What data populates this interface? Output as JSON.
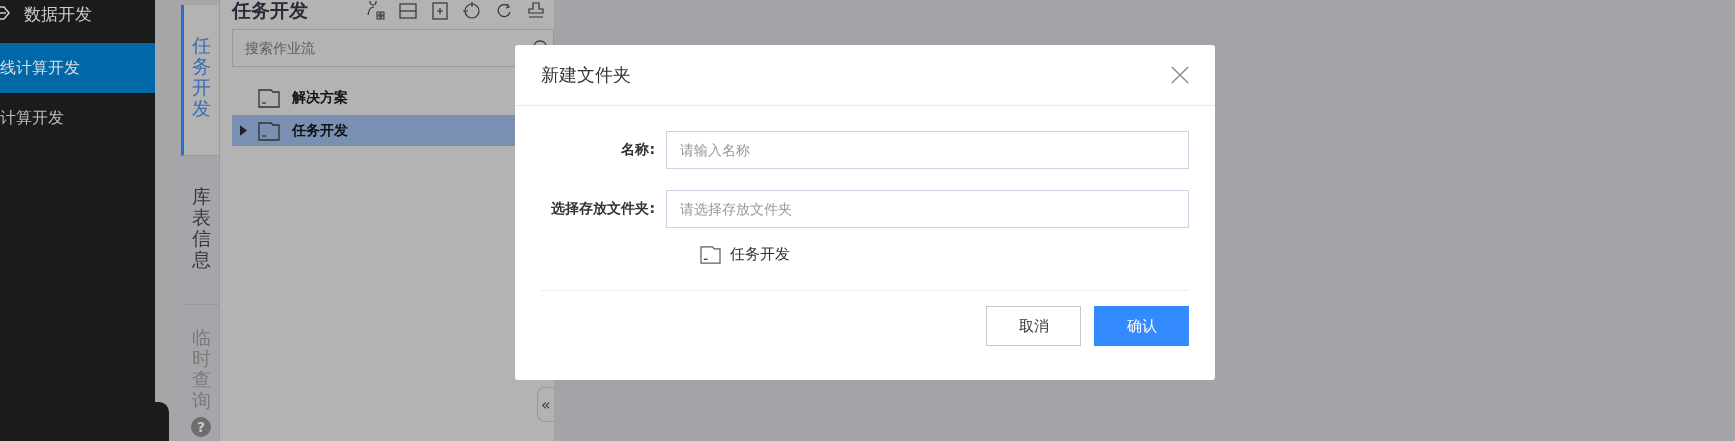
{
  "sidebar": {
    "header": "数据开发",
    "items": [
      {
        "label": "线计算开发",
        "selected": true
      },
      {
        "label": "计算开发",
        "selected": false
      }
    ]
  },
  "side_tabs": [
    {
      "label": "任务开发",
      "selected": true,
      "disabled": false
    },
    {
      "label": "库表信息",
      "selected": false,
      "disabled": false
    },
    {
      "label": "临时查询",
      "selected": false,
      "disabled": true
    }
  ],
  "help": "?",
  "panel": {
    "title": "任务开发",
    "search": {
      "placeholder": "搜索作业流"
    },
    "tree": [
      {
        "label": "解决方案",
        "selected": false,
        "has_children": false
      },
      {
        "label": "任务开发",
        "selected": true,
        "has_children": true
      }
    ],
    "collapse": "«"
  },
  "dialog": {
    "title": "新建文件夹",
    "fields": [
      {
        "label": "名称:",
        "placeholder": "请输入名称"
      },
      {
        "label": "选择存放文件夹:",
        "placeholder": "请选择存放文件夹"
      }
    ],
    "folder": "任务开发",
    "buttons": [
      {
        "label": "取消",
        "kind": "secondary"
      },
      {
        "label": "确认",
        "kind": "primary"
      }
    ]
  }
}
